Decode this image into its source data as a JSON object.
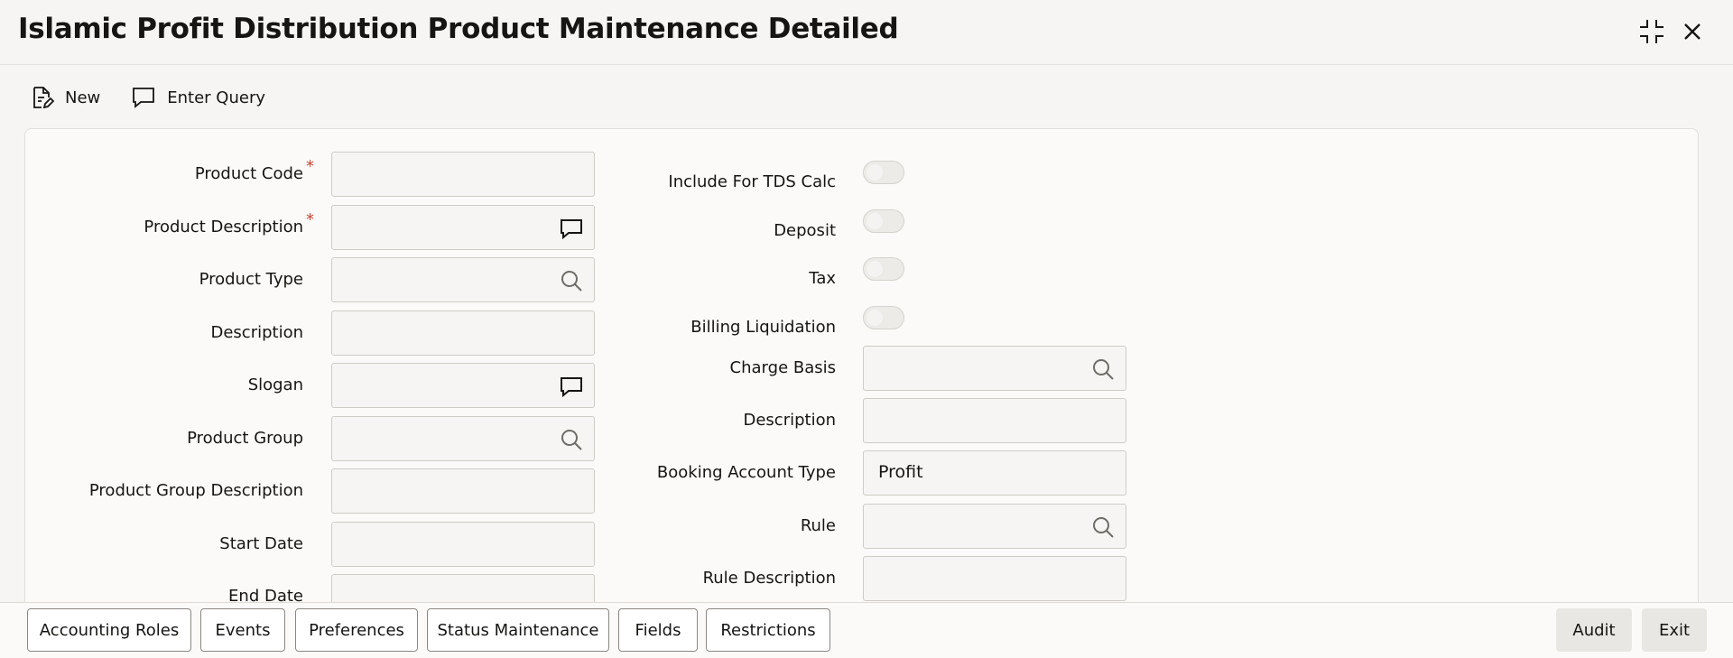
{
  "window": {
    "title": "Islamic Profit Distribution Product Maintenance Detailed",
    "restore_icon": "collapse-icon",
    "close_icon": "close-icon"
  },
  "toolbar": {
    "new_label": "New",
    "enter_query_label": "Enter Query"
  },
  "left_fields": [
    {
      "label": "Product Code",
      "required": "*",
      "value": "",
      "icon": ""
    },
    {
      "label": "Product Description",
      "required": "*",
      "value": "",
      "icon": "comment-icon"
    },
    {
      "label": "Product Type",
      "required": "",
      "value": "",
      "icon": "search-icon"
    },
    {
      "label": "Description",
      "required": "",
      "value": "",
      "icon": ""
    },
    {
      "label": "Slogan",
      "required": "",
      "value": "",
      "icon": "comment-icon"
    },
    {
      "label": "Product Group",
      "required": "",
      "value": "",
      "icon": "search-icon"
    },
    {
      "label": "Product Group Description",
      "required": "",
      "value": "",
      "icon": ""
    },
    {
      "label": "Start Date",
      "required": "",
      "value": "",
      "icon": ""
    },
    {
      "label": "End Date",
      "required": "",
      "value": "",
      "icon": ""
    }
  ],
  "toggles": [
    {
      "label": "Include For TDS Calc",
      "checked": false
    },
    {
      "label": "Deposit",
      "checked": false
    },
    {
      "label": "Tax",
      "checked": false
    },
    {
      "label": "Billing Liquidation",
      "checked": false
    }
  ],
  "right_fields": [
    {
      "label": "Charge Basis",
      "value": "",
      "icon": "search-icon"
    },
    {
      "label": "Description",
      "value": "",
      "icon": ""
    },
    {
      "label": "Booking Account Type",
      "value": "Profit",
      "icon": ""
    },
    {
      "label": "Rule",
      "value": "",
      "icon": "search-icon"
    },
    {
      "label": "Rule Description",
      "value": "",
      "icon": ""
    }
  ],
  "footer": {
    "buttons": [
      "Accounting Roles",
      "Events",
      "Preferences",
      "Status Maintenance",
      "Fields",
      "Restrictions"
    ],
    "audit_label": "Audit",
    "exit_label": "Exit"
  }
}
